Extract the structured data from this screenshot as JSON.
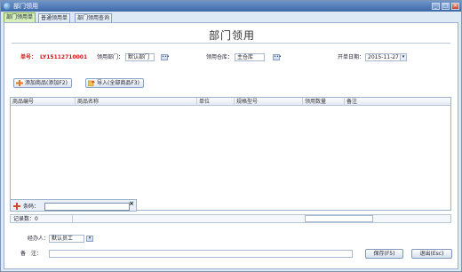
{
  "window": {
    "title": "部门领用"
  },
  "tabs": [
    {
      "label": "部门领用单"
    },
    {
      "label": "普通领用单"
    },
    {
      "label": "部门领用查询"
    }
  ],
  "form": {
    "title": "部门领用",
    "order_label": "单号：",
    "order_value": "LY15112710001",
    "dept_label": "领用部门：",
    "dept_value": "默认部门",
    "warehouse_label": "领用仓库：",
    "warehouse_value": "主仓库",
    "date_label": "开单日期：",
    "date_value": "2015-11-27"
  },
  "toolbar": {
    "add_item_label": "添加商品(添加F2)",
    "import_label": "导入(全部商品F3)"
  },
  "grid": {
    "columns": [
      "商品编号",
      "商品名称",
      "单位",
      "规格型号",
      "领用数量",
      "备注"
    ]
  },
  "scan": {
    "label": "条码：",
    "close": "×"
  },
  "status": {
    "record_label": "记录数：0"
  },
  "footer": {
    "handler_label": "经办人：",
    "handler_value": "默认员工",
    "remark_label": "备　注：",
    "save_label": "保存(F5)",
    "exit_label": "退出(Esc)"
  }
}
